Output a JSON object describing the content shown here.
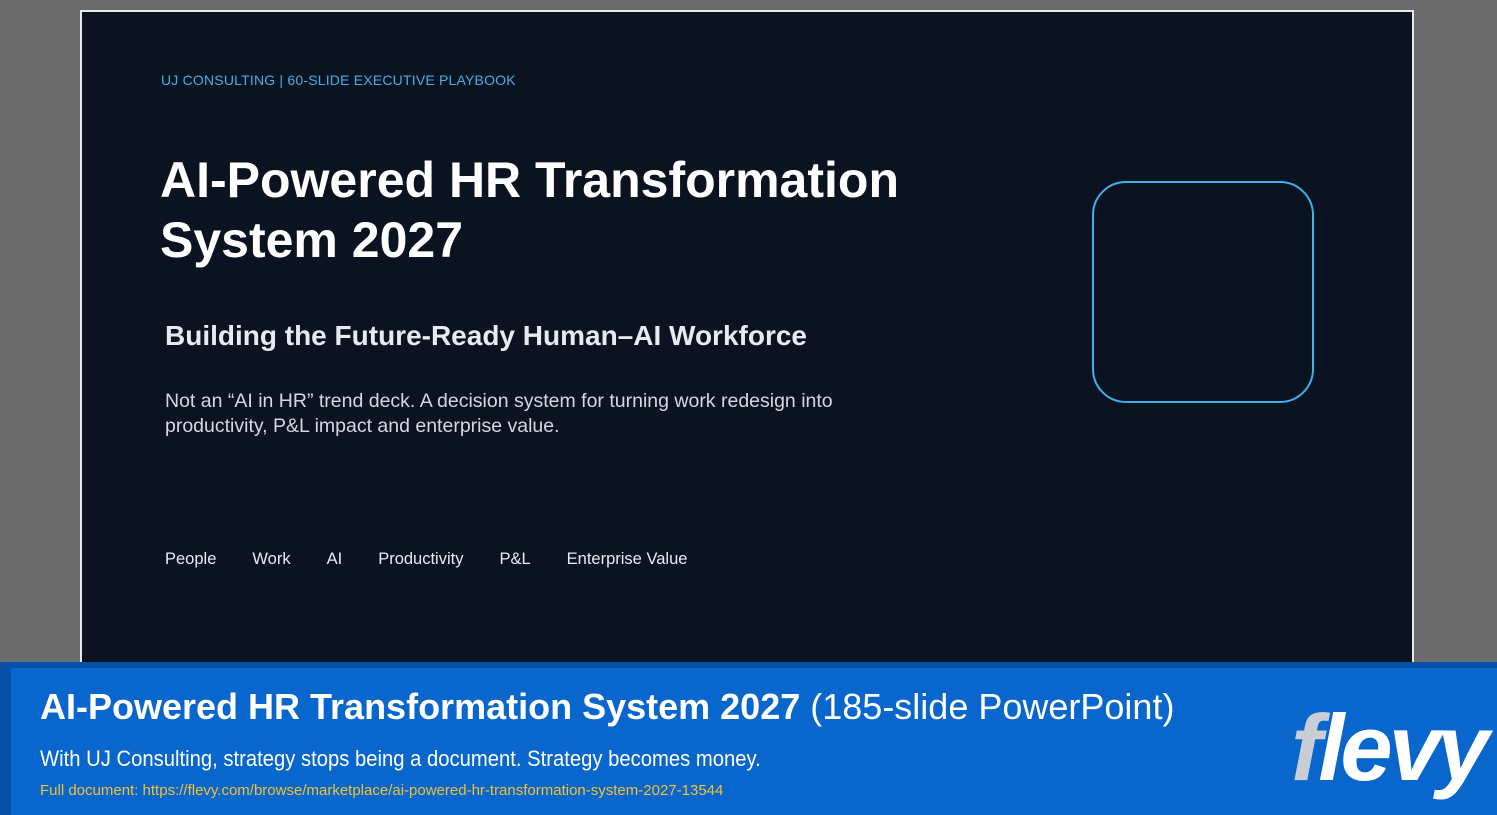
{
  "slide": {
    "eyebrow": "UJ CONSULTING | 60-SLIDE EXECUTIVE PLAYBOOK",
    "title_line1": "AI-Powered HR Transformation",
    "title_line2": "System 2027",
    "subtitle": "Building the Future-Ready Human–AI Workforce",
    "description": "Not an “AI in HR” trend deck. A decision system for turning work redesign into productivity, P&L impact and enterprise value.",
    "tags": [
      "People",
      "Work",
      "AI",
      "Productivity",
      "P&L",
      "Enterprise Value"
    ]
  },
  "banner": {
    "title": "AI-Powered HR Transformation System 2027",
    "title_suffix": "(185-slide PowerPoint)",
    "tagline": "With UJ Consulting, strategy stops being a document. Strategy becomes money.",
    "link_text": "Full document: https://flevy.com/browse/marketplace/ai-powered-hr-transformation-system-2027-13544",
    "logo_first_letter": "f",
    "logo_rest": "levy"
  },
  "colors": {
    "slide_background": "#0b1320",
    "accent": "#3fb0ea",
    "banner_blue": "#0866cc",
    "link_yellow": "#f2c230"
  }
}
